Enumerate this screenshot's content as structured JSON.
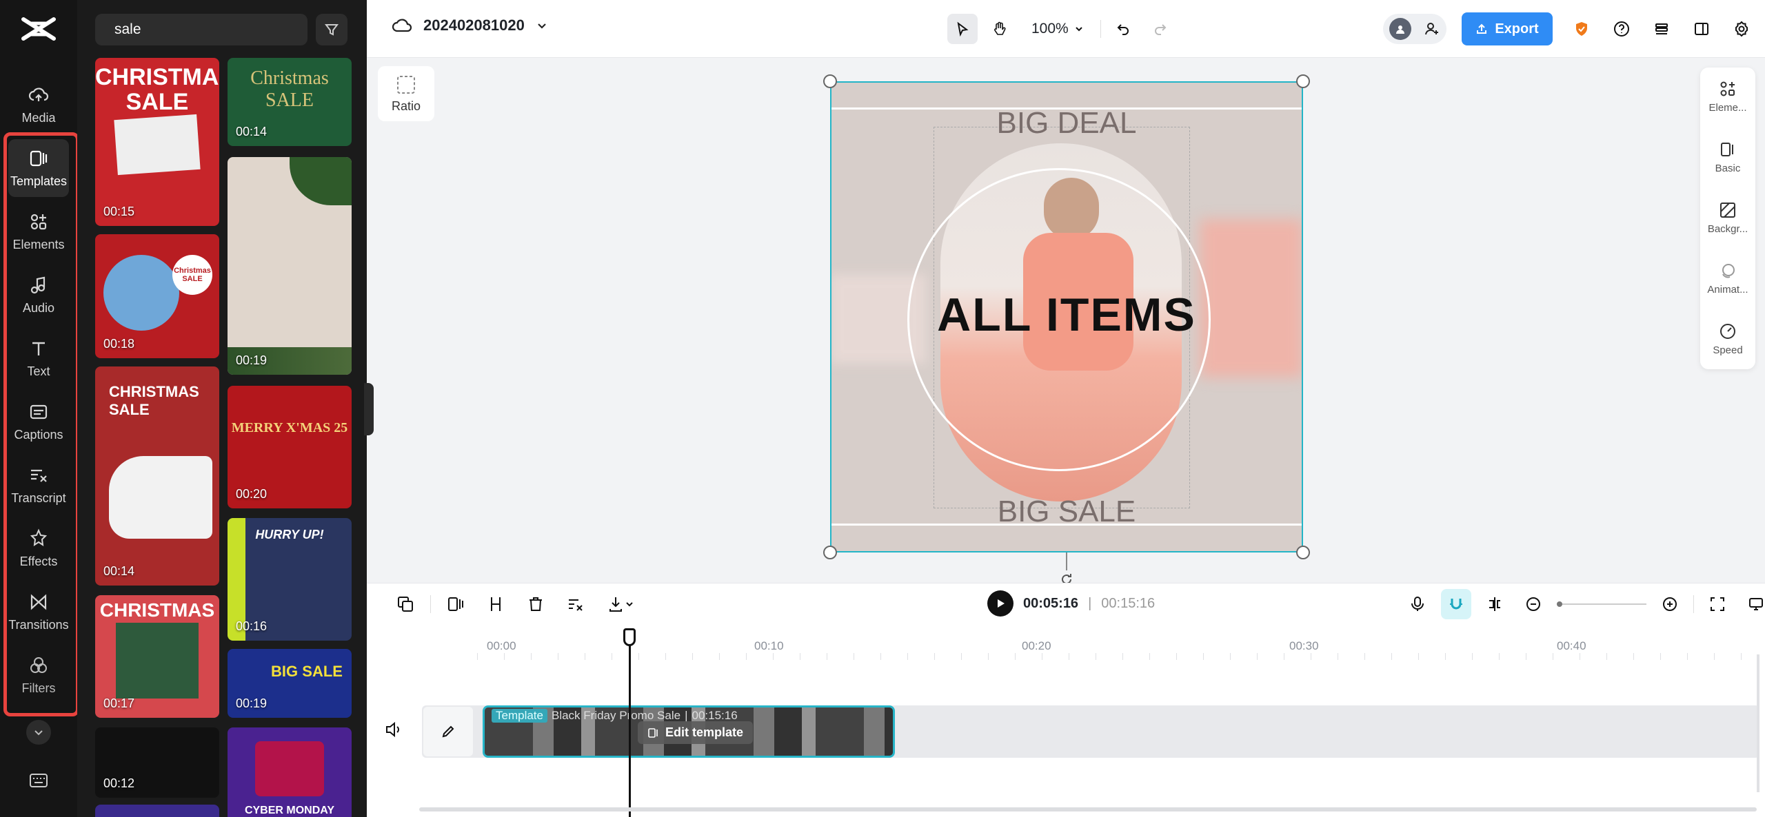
{
  "rail": {
    "items": [
      {
        "label": "Media",
        "icon": "cloud-upload-icon"
      },
      {
        "label": "Templates",
        "icon": "template-icon"
      },
      {
        "label": "Elements",
        "icon": "elements-icon"
      },
      {
        "label": "Audio",
        "icon": "music-note-icon"
      },
      {
        "label": "Text",
        "icon": "text-icon"
      },
      {
        "label": "Captions",
        "icon": "captions-icon"
      },
      {
        "label": "Transcript",
        "icon": "transcript-icon"
      },
      {
        "label": "Effects",
        "icon": "effects-icon"
      },
      {
        "label": "Transitions",
        "icon": "transitions-icon"
      },
      {
        "label": "Filters",
        "icon": "filters-icon"
      }
    ],
    "active_item": "Templates",
    "highlight_color": "#e8433e"
  },
  "panel": {
    "search_value": "sale",
    "cards": [
      {
        "title": "CHRISTMAS SALE",
        "duration": "00:15",
        "color": "#c7252a"
      },
      {
        "title": "Christmas SALE",
        "duration": "00:14",
        "color": "#1f5c37"
      },
      {
        "title": "",
        "duration": "00:19",
        "color": "#e0d6cc"
      },
      {
        "title": "Christmas SALE",
        "duration": "00:18",
        "color": "#b81d22"
      },
      {
        "title": "CHRISTMAS SALE",
        "duration": "00:14",
        "color": "#a82a2a"
      },
      {
        "title": "MERRY X'MAS 25",
        "duration": "00:20",
        "color": "#b3171c"
      },
      {
        "title": "HURRY UP!",
        "duration": "00:16",
        "color": "#2a3660"
      },
      {
        "title": "CHRISTMAS",
        "duration": "00:17",
        "color": "#d5484d"
      },
      {
        "title": "BIG SALE",
        "duration": "00:19",
        "color": "#1c2f8c"
      },
      {
        "title": "",
        "duration": "00:12",
        "color": "#111111"
      },
      {
        "title": "CYBER MONDAY",
        "duration": "",
        "color": "#4a2290"
      }
    ]
  },
  "topbar": {
    "project_name": "202402081020",
    "zoom": "100%",
    "export_label": "Export",
    "accent": "#2f8cf5"
  },
  "canvas": {
    "ratio_label": "Ratio",
    "top_text": "BIG DEAL",
    "middle_text": "ALL ITEMS",
    "bottom_text": "BIG SALE"
  },
  "right_panel": {
    "items": [
      "Eleme...",
      "Basic",
      "Backgr...",
      "Animat...",
      "Speed"
    ]
  },
  "timeline": {
    "current_time": "00:05:16",
    "total_time": "00:15:16",
    "ticks": [
      "00:00",
      "00:10",
      "00:20",
      "00:30",
      "00:40"
    ],
    "clip_tag": "Template",
    "clip_name": "Black Friday Promo Sale",
    "clip_duration": "00:15:16",
    "edit_template_label": "Edit template"
  }
}
